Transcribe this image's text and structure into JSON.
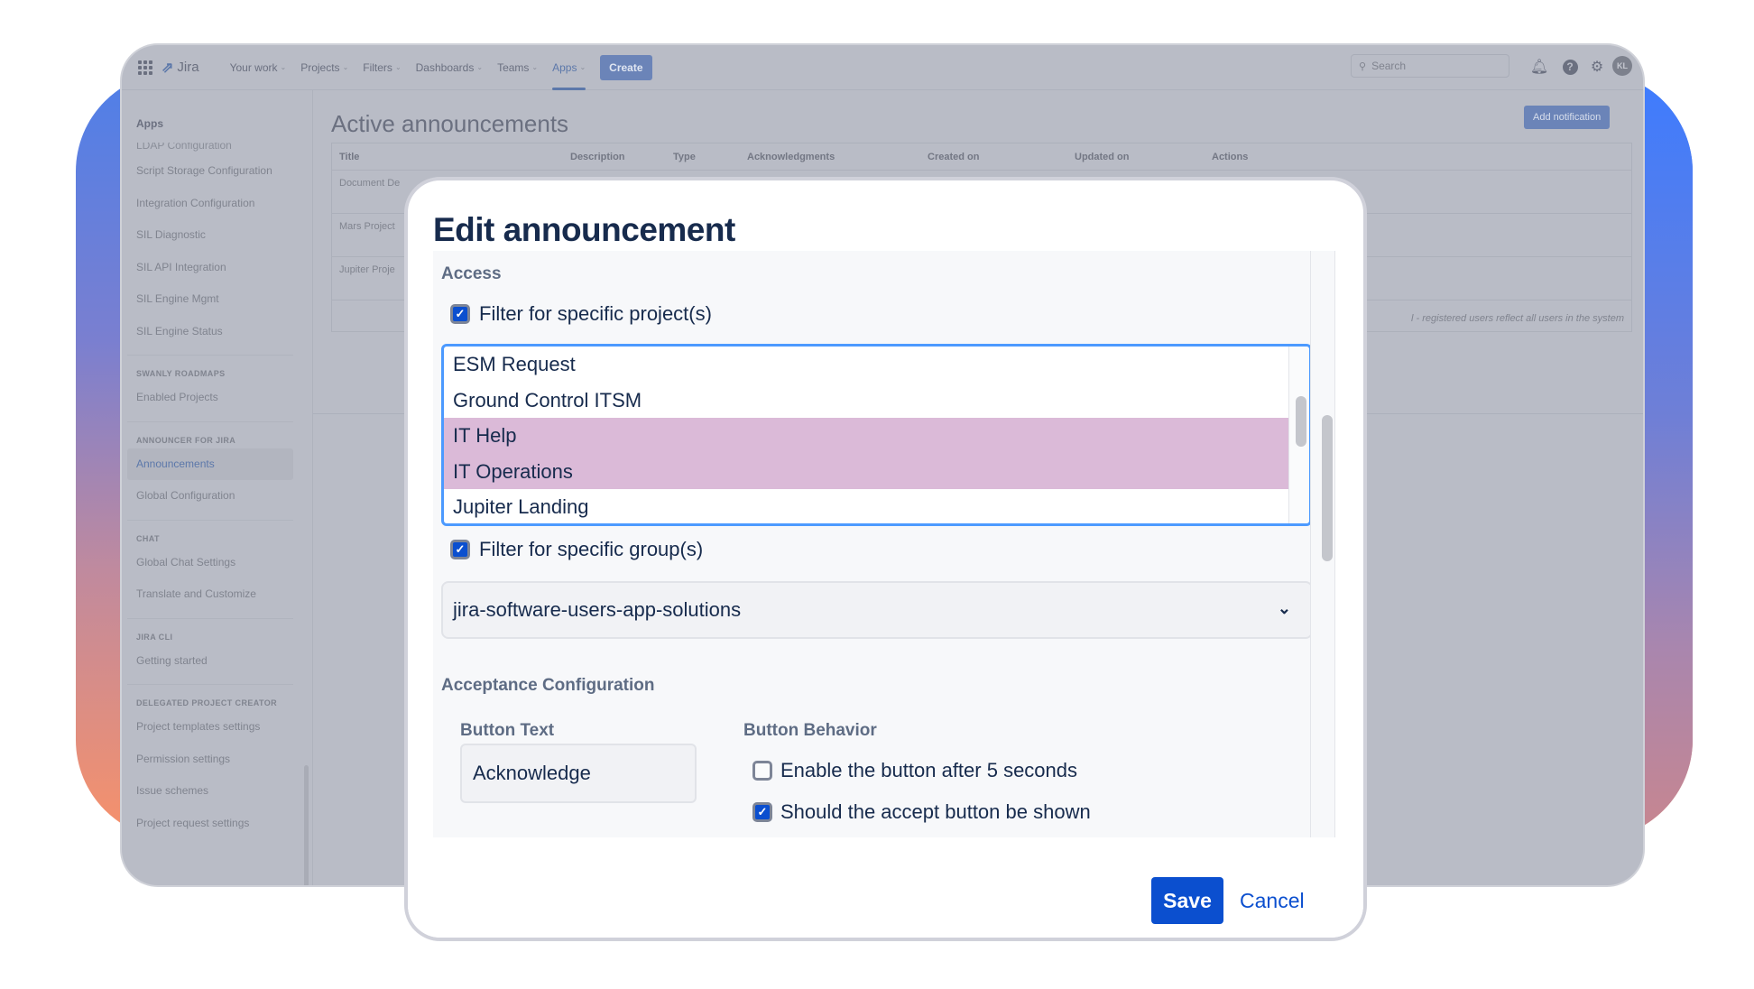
{
  "topbar": {
    "product": "Jira",
    "nav": [
      {
        "label": "Your work",
        "active": false
      },
      {
        "label": "Projects",
        "active": false
      },
      {
        "label": "Filters",
        "active": false
      },
      {
        "label": "Dashboards",
        "active": false
      },
      {
        "label": "Teams",
        "active": false
      },
      {
        "label": "Apps",
        "active": true
      }
    ],
    "create_label": "Create",
    "search_placeholder": "Search",
    "avatar_initials": "KL",
    "icons": [
      "notifications-icon",
      "help-icon",
      "settings-icon"
    ]
  },
  "sidebar": {
    "title": "Apps",
    "partial_item": "LDAP Configuration",
    "items_top": [
      "Script Storage Configuration",
      "Integration Configuration",
      "SIL Diagnostic",
      "SIL API Integration",
      "SIL Engine Mgmt",
      "SIL Engine Status"
    ],
    "sections": [
      {
        "heading": "SWANLY ROADMAPS",
        "items": [
          "Enabled Projects"
        ]
      },
      {
        "heading": "ANNOUNCER FOR JIRA",
        "items": [
          "Announcements",
          "Global Configuration"
        ],
        "active": "Announcements"
      },
      {
        "heading": "CHAT",
        "items": [
          "Global Chat Settings",
          "Translate and Customize"
        ]
      },
      {
        "heading": "JIRA CLI",
        "items": [
          "Getting started"
        ]
      },
      {
        "heading": "DELEGATED PROJECT CREATOR",
        "items": [
          "Project templates settings",
          "Permission settings",
          "Issue schemes",
          "Project request settings"
        ]
      }
    ]
  },
  "main": {
    "title": "Active announcements",
    "add_button": "Add notification",
    "columns": [
      "Title",
      "Description",
      "Type",
      "Acknowledgments",
      "Created on",
      "Updated on",
      "Actions"
    ],
    "rows": [
      {
        "title": "Document De"
      },
      {
        "title": "Mars Project"
      },
      {
        "title": "Jupiter Proje"
      }
    ],
    "footnote": "l - registered users reflect all users in the system"
  },
  "modal": {
    "title": "Edit announcement",
    "access_label": "Access",
    "filter_projects": {
      "label": "Filter for specific project(s)",
      "checked": true
    },
    "projects": [
      {
        "name": "ESM Request",
        "selected": false
      },
      {
        "name": "Ground Control ITSM",
        "selected": false
      },
      {
        "name": "IT Help",
        "selected": true
      },
      {
        "name": "IT Operations",
        "selected": true
      },
      {
        "name": "Jupiter Landing",
        "selected": false
      }
    ],
    "filter_groups": {
      "label": "Filter for specific group(s)",
      "checked": true
    },
    "group_value": "jira-software-users-app-solutions",
    "acceptance_label": "Acceptance Configuration",
    "button_text_label": "Button Text",
    "button_text_value": "Acknowledge",
    "button_behavior_label": "Button Behavior",
    "enable_after": {
      "label": "Enable the button after 5 seconds",
      "checked": false
    },
    "show_accept": {
      "label": "Should the accept button be shown",
      "checked": true
    },
    "save_label": "Save",
    "cancel_label": "Cancel"
  }
}
